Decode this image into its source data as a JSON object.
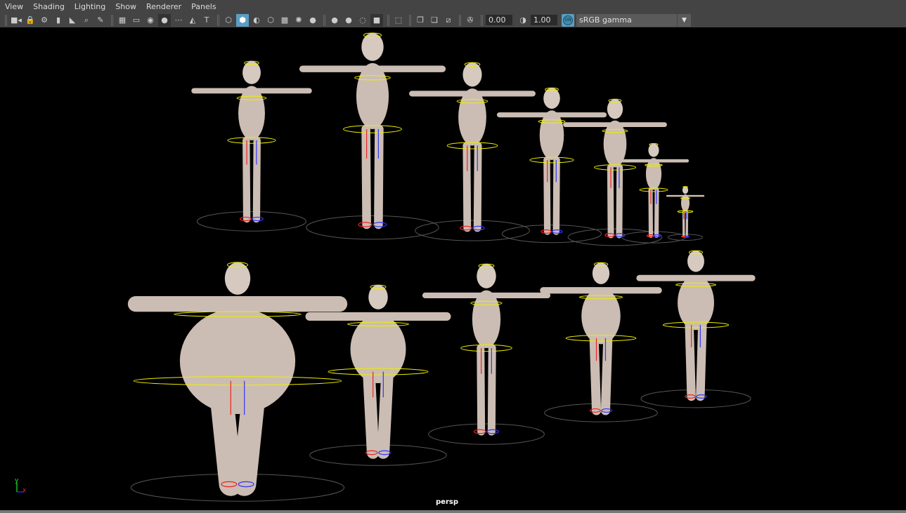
{
  "menubar": [
    "View",
    "Shading",
    "Lighting",
    "Show",
    "Renderer",
    "Panels"
  ],
  "toolbar": {
    "groups": [
      [
        {
          "icon": "camera-icon",
          "glyph": "■◂"
        },
        {
          "icon": "lock-camera-icon",
          "glyph": "🔒"
        },
        {
          "icon": "camera-attributes-icon",
          "glyph": "⚙"
        },
        {
          "icon": "bookmark-icon",
          "glyph": "▮"
        },
        {
          "icon": "image-plane-icon",
          "glyph": "◣"
        },
        {
          "icon": "2d-pan-zoom-icon",
          "glyph": "⌕"
        },
        {
          "icon": "grease-pencil-icon",
          "glyph": "✎"
        }
      ],
      [
        {
          "icon": "grid-icon",
          "glyph": "▦"
        },
        {
          "icon": "film-gate-icon",
          "glyph": "▭"
        },
        {
          "icon": "resolution-gate-icon",
          "glyph": "◉"
        },
        {
          "icon": "gate-mask-icon",
          "glyph": "●",
          "dark": true
        },
        {
          "icon": "field-chart-icon",
          "glyph": "⋯"
        },
        {
          "icon": "safe-action-icon",
          "glyph": "◭"
        },
        {
          "icon": "safe-title-icon",
          "glyph": "T"
        }
      ],
      [
        {
          "icon": "wireframe-icon",
          "glyph": "⬡"
        },
        {
          "icon": "smooth-shade-icon",
          "glyph": "⬢",
          "active": true
        },
        {
          "icon": "default-material-icon",
          "glyph": "◐"
        },
        {
          "icon": "wireframe-on-shaded-icon",
          "glyph": "⬡"
        },
        {
          "icon": "textured-icon",
          "glyph": "▩"
        },
        {
          "icon": "use-all-lights-icon",
          "glyph": "✺"
        },
        {
          "icon": "shadows-icon",
          "glyph": "●"
        }
      ],
      [
        {
          "icon": "screen-space-ambient-occlusion-icon",
          "glyph": "●"
        },
        {
          "icon": "motion-blur-icon",
          "glyph": "●"
        },
        {
          "icon": "multisample-antialiasing-icon",
          "glyph": "◌"
        },
        {
          "icon": "depth-of-field-icon",
          "glyph": "■",
          "dark": true
        }
      ],
      [
        {
          "icon": "isolate-select-icon",
          "glyph": "⬚"
        }
      ],
      [
        {
          "icon": "xray-icon",
          "glyph": "❐"
        },
        {
          "icon": "xray-active-components-icon",
          "glyph": "❏"
        },
        {
          "icon": "xray-joints-icon",
          "glyph": "⧄"
        }
      ],
      [
        {
          "icon": "exposure-icon",
          "glyph": "✇"
        }
      ]
    ],
    "exposure": "0.00",
    "gamma_icon": "gamma-icon",
    "gamma": "1.00",
    "color_management_label": "ON",
    "color_space": "sRGB gamma"
  },
  "viewport": {
    "camera_label": "persp",
    "axis_y": "y",
    "axis_x": "x"
  }
}
